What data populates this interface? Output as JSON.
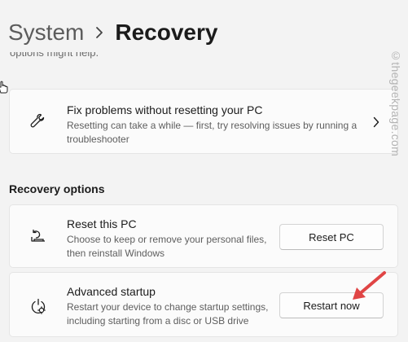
{
  "header": {
    "parent": "System",
    "current": "Recovery"
  },
  "cut_off_text": "options might help.",
  "fix_card": {
    "title": "Fix problems without resetting your PC",
    "description": "Resetting can take a while — first, try resolving issues by running a\ntroubleshooter",
    "icon": "wrench-icon",
    "chevron": "chevron-right-icon"
  },
  "recovery_options": {
    "heading": "Recovery options",
    "items": [
      {
        "title": "Reset this PC",
        "description": "Choose to keep or remove your personal files,\nthen reinstall Windows",
        "button": "Reset PC",
        "icon": "reset-pc-icon"
      },
      {
        "title": "Advanced startup",
        "description": "Restart your device to change startup settings,\nincluding starting from a disc or USB drive",
        "button": "Restart now",
        "icon": "advanced-startup-icon"
      }
    ]
  },
  "watermark": "©thegeekpage.com",
  "colors": {
    "background": "#f3f3f3",
    "card": "#fbfbfb",
    "arrow": "#e04545"
  }
}
